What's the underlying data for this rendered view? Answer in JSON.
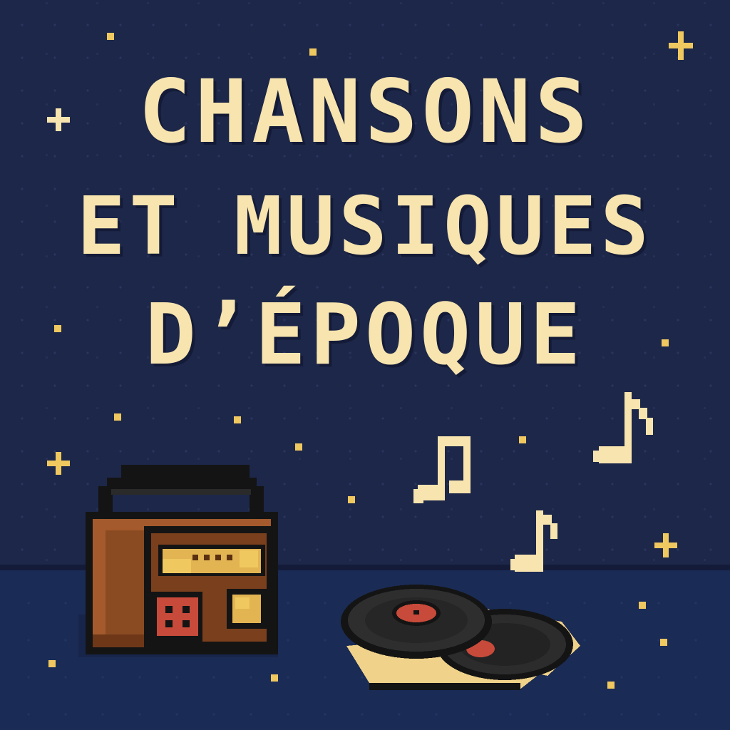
{
  "title": {
    "line_1": "CHANSONS",
    "line_2": "ET MUSIQUES",
    "line_3": "D’ÉPOQUE"
  },
  "icons": {
    "radio": "retro-radio-icon",
    "records": "vinyl-records-icon",
    "note": "music-note-icon",
    "sparkle": "sparkle-star-icon"
  },
  "colors": {
    "background": "#1d2749",
    "floor": "#1a2b55",
    "title": "#f7e4ae",
    "radio_body": "#8a4a22",
    "radio_speaker": "#c84a3a",
    "record_label": "#c84a3a",
    "accent_gold": "#f0c860"
  }
}
